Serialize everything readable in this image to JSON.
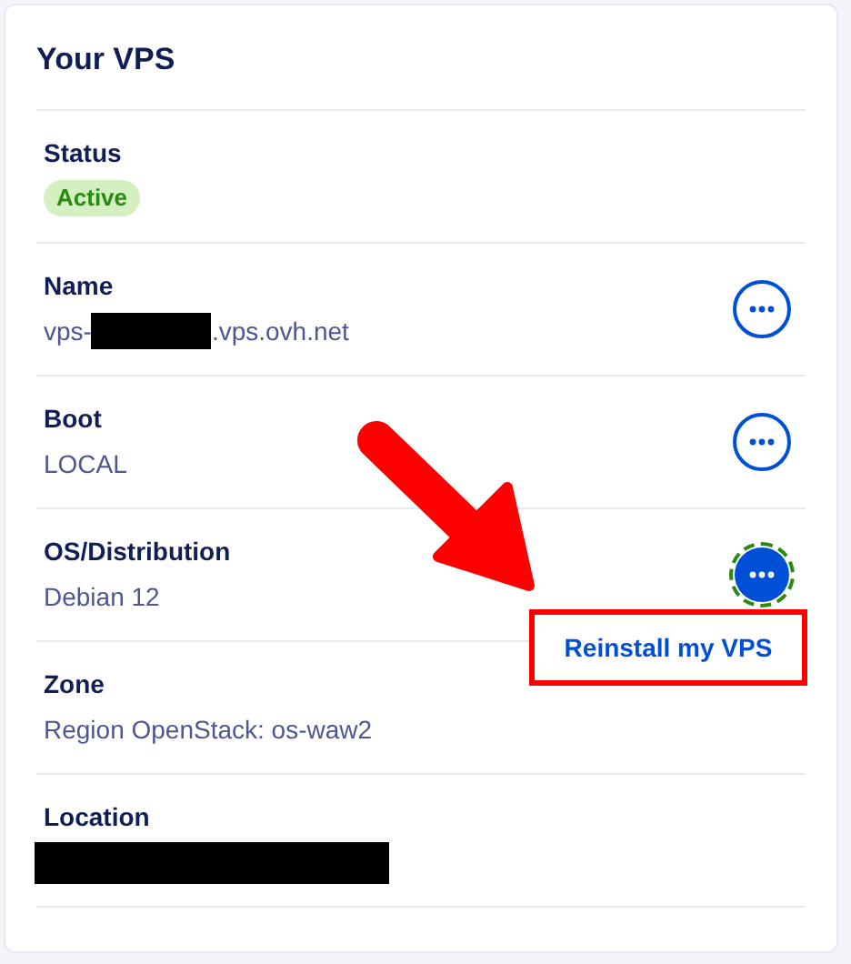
{
  "card": {
    "title": "Your VPS",
    "rows": [
      {
        "label": "Status",
        "segments": [
          {
            "kind": "badge",
            "text": "Active"
          }
        ]
      },
      {
        "label": "Name",
        "segments": [
          {
            "kind": "text",
            "text": "vps-"
          },
          {
            "kind": "redacted"
          },
          {
            "kind": "text",
            "text": ".vps.ovh.net"
          }
        ],
        "menu_open": false
      },
      {
        "label": "Boot",
        "segments": [
          {
            "kind": "text",
            "text": "LOCAL"
          }
        ],
        "menu_open": false
      },
      {
        "label": "OS/Distribution",
        "segments": [
          {
            "kind": "text",
            "text": "Debian 12"
          }
        ],
        "menu_open": true,
        "menu_items": [
          "Reinstall my VPS"
        ]
      },
      {
        "label": "Zone",
        "segments": [
          {
            "kind": "text",
            "text": "Region OpenStack: os-waw2"
          }
        ]
      },
      {
        "label": "Location",
        "segments": [
          {
            "kind": "redacted"
          }
        ]
      }
    ]
  }
}
